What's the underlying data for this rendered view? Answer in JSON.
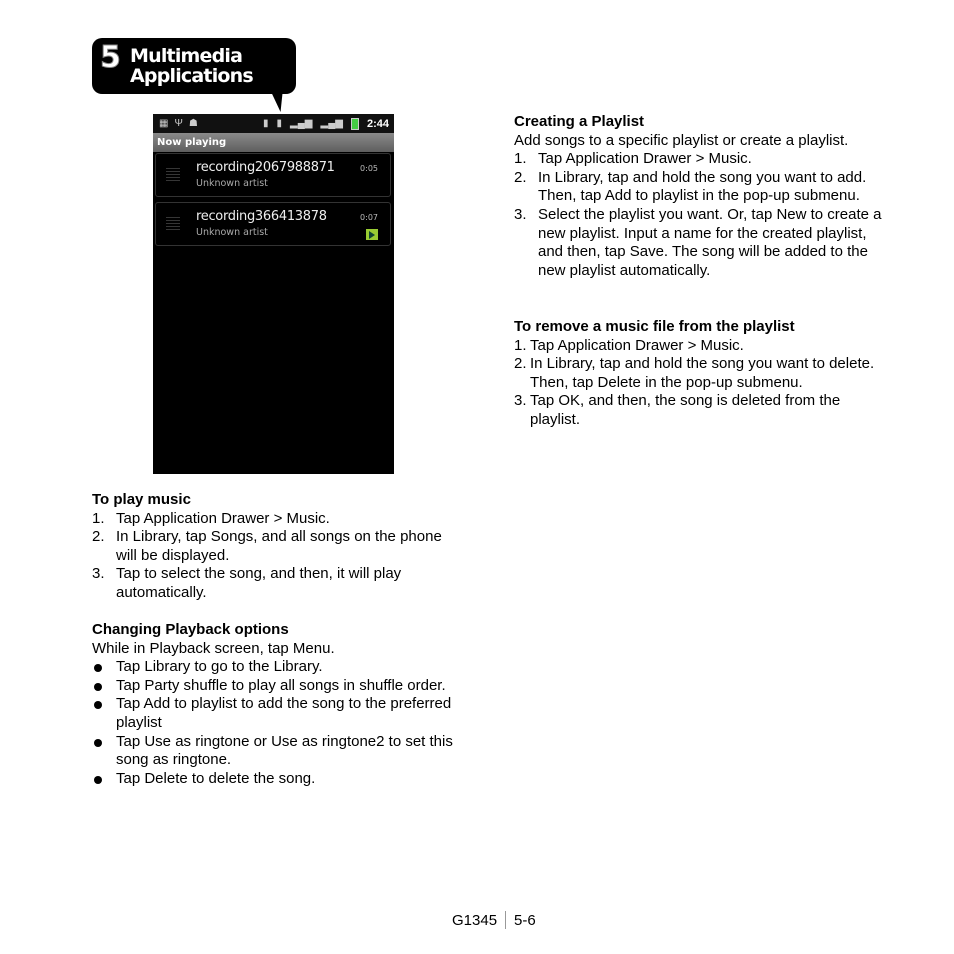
{
  "header": {
    "chapter_number": "5",
    "title_line1": "Multimedia",
    "title_line2": "Applications"
  },
  "phone": {
    "status_time": "2:44",
    "screen_title": "Now playing",
    "tracks": [
      {
        "name": "recording2067988871",
        "artist": "Unknown artist",
        "duration": "0:05",
        "playing": false
      },
      {
        "name": "recording366413878",
        "artist": "Unknown artist",
        "duration": "0:07",
        "playing": true
      }
    ]
  },
  "play_music": {
    "heading": "To play music",
    "steps": [
      {
        "n": "1.",
        "text": "Tap Application Drawer > Music."
      },
      {
        "n": "2.",
        "text": "In Library, tap Songs, and all songs on the phone will be displayed."
      },
      {
        "n": "3.",
        "text": "Tap to select the song, and then, it will play automatically."
      }
    ]
  },
  "playback": {
    "heading": "Changing Playback options",
    "intro": "While in Playback screen, tap Menu.",
    "bullets": [
      "Tap Library to go to the Library.",
      "Tap Party shuffle to play all songs in shuffle order.",
      "Tap Add to playlist to add the song to the preferred playlist",
      "Tap Use as ringtone or Use as ringtone2 to set this song as ringtone.",
      "Tap Delete to delete the song."
    ]
  },
  "create_playlist": {
    "heading": "Creating a Playlist",
    "intro": "Add songs to a specific playlist or create a playlist.",
    "steps": [
      {
        "n": "1.",
        "text": "Tap Application Drawer > Music."
      },
      {
        "n": "2.",
        "text": "In Library, tap and hold the song you want to add. Then, tap Add to playlist in the pop-up submenu."
      },
      {
        "n": "3.",
        "text": "Select the playlist you want. Or, tap New to create a new playlist. Input a name for the created playlist, and then, tap Save. The song will be added to the new playlist automatically."
      }
    ]
  },
  "remove": {
    "heading": "To remove a music file from the playlist",
    "steps": [
      {
        "n": "1.",
        "text": "Tap Application Drawer > Music."
      },
      {
        "n": "2.",
        "text": "In Library, tap and hold the song you want to delete. Then, tap Delete in the pop-up submenu."
      },
      {
        "n": "3.",
        "text": "Tap OK, and then, the song is deleted from the playlist."
      }
    ]
  },
  "footer": {
    "model": "G1345",
    "page": "5-6"
  }
}
